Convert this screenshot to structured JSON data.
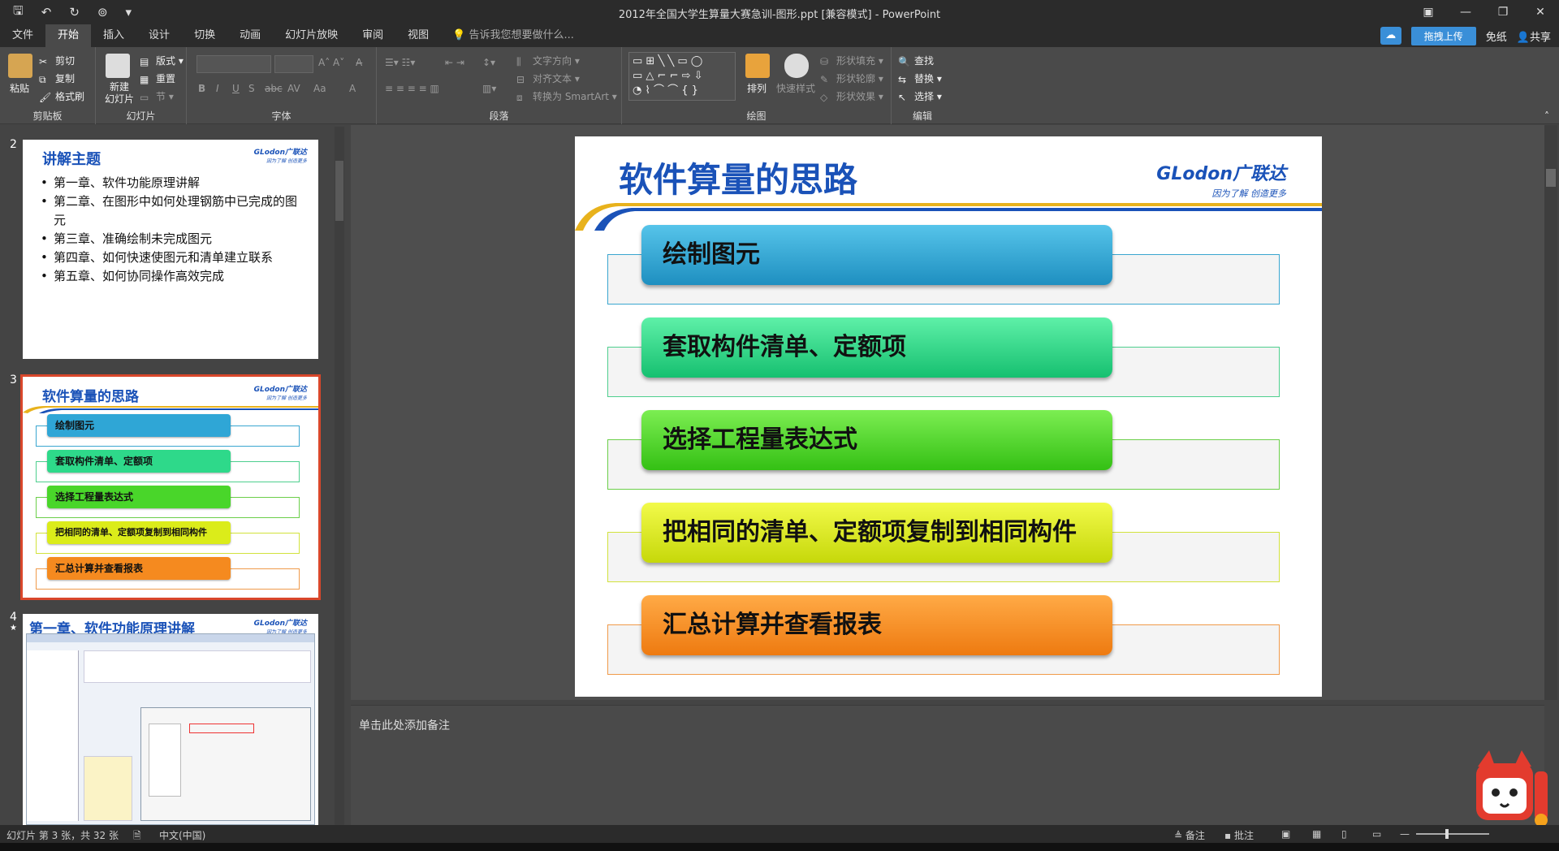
{
  "window": {
    "title": "2012年全国大学生算量大赛急训-图形.ppt [兼容模式] - PowerPoint"
  },
  "tabs": [
    {
      "label": "文件"
    },
    {
      "label": "开始"
    },
    {
      "label": "插入"
    },
    {
      "label": "设计"
    },
    {
      "label": "切换"
    },
    {
      "label": "动画"
    },
    {
      "label": "幻灯片放映"
    },
    {
      "label": "审阅"
    },
    {
      "label": "视图"
    }
  ],
  "tellme": "告诉我您想要做什么...",
  "account": {
    "upload": "拖拽上传",
    "free": "免纸",
    "share": "共享"
  },
  "ribbon": {
    "clipboard": {
      "label": "剪贴板",
      "paste": "粘贴",
      "cut": "剪切",
      "copy": "复制",
      "format_painter": "格式刷"
    },
    "slides": {
      "label": "幻灯片",
      "new_slide": "新建\n幻灯片",
      "layout": "版式",
      "reset": "重置",
      "section": "节"
    },
    "font": {
      "label": "字体",
      "bold": "B",
      "italic": "I",
      "underline": "U",
      "shadow": "S",
      "strike": "abc",
      "spacing": "AV",
      "case": "Aa",
      "color": "A"
    },
    "paragraph": {
      "label": "段落",
      "text_direction": "文字方向",
      "align_text": "对齐文本",
      "smartart": "转换为 SmartArt"
    },
    "drawing": {
      "label": "绘图",
      "arrange": "排列",
      "quick_styles": "快速样式",
      "shape_fill": "形状填充",
      "shape_outline": "形状轮廓",
      "shape_effects": "形状效果"
    },
    "editing": {
      "label": "编辑",
      "find": "查找",
      "replace": "替换",
      "select": "选择"
    }
  },
  "thumbnails": [
    {
      "number": "2",
      "title": "讲解主题",
      "bullets": [
        "第一章、软件功能原理讲解",
        "第二章、在图形中如何处理钢筋中已完成的图元",
        "第三章、准确绘制未完成图元",
        "第四章、如何快速使图元和清单建立联系",
        "第五章、如何协同操作高效完成"
      ]
    },
    {
      "number": "3",
      "title": "软件算量的思路"
    },
    {
      "number": "4",
      "star": "★",
      "title": "第一章、软件功能原理讲解"
    }
  ],
  "logo": {
    "brand": "GLodon广联达",
    "tagline": "因为了解 创造更多"
  },
  "slide": {
    "title": "软件算量的思路",
    "steps": [
      {
        "label": "绘制图元",
        "color": "#2fa6d6",
        "border": "#3aa6d0"
      },
      {
        "label": "套取构件清单、定额项",
        "color": "#2ed98a",
        "border": "#4ecf8e"
      },
      {
        "label": "选择工程量表达式",
        "color": "#49d62a",
        "border": "#6ccf4a"
      },
      {
        "label": "把相同的清单、定额项复制到相同构件",
        "color": "#dbec1a",
        "border": "#d2e23c"
      },
      {
        "label": "汇总计算并查看报表",
        "color": "#f58a1f",
        "border": "#f09a4a"
      }
    ]
  },
  "notes": {
    "placeholder": "单击此处添加备注"
  },
  "status": {
    "slide_info": "幻灯片 第 3 张，共 32 张",
    "language": "中文(中国)",
    "notes_btn": "备注",
    "comments_btn": "批注"
  }
}
